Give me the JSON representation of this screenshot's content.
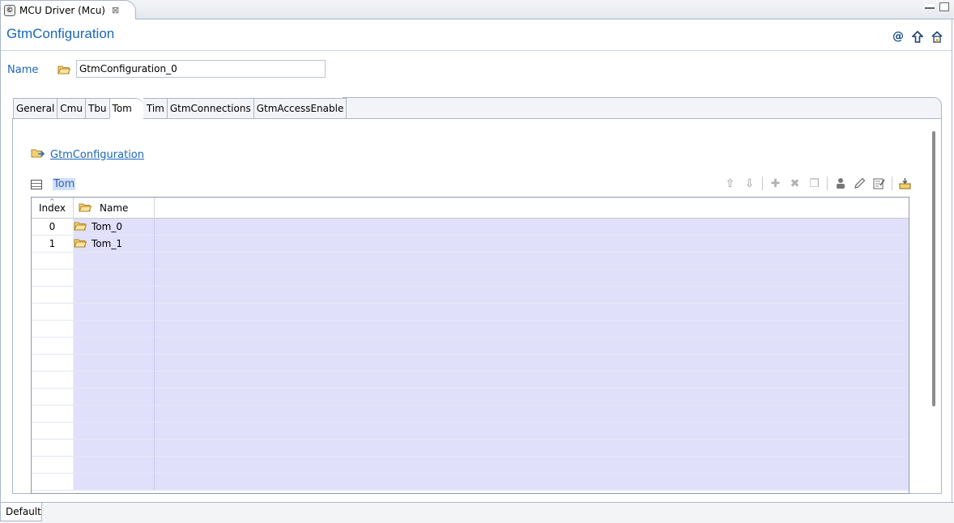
{
  "editor": {
    "tab_title": "MCU Driver (Mcu)",
    "close_glyph": "⊠"
  },
  "header": {
    "title": "GtmConfiguration"
  },
  "name_field": {
    "label": "Name",
    "value": "GtmConfiguration_0"
  },
  "tabs": [
    "General",
    "Cmu",
    "Tbu",
    "Tom",
    "Tim",
    "GtmConnections",
    "GtmAccessEnable"
  ],
  "active_tab": "Tom",
  "breadcrumb": {
    "link": "GtmConfiguration"
  },
  "table": {
    "title": "Tom",
    "columns": [
      "Index",
      "Name"
    ],
    "rows": [
      {
        "index": "0",
        "name": "Tom_0"
      },
      {
        "index": "1",
        "name": "Tom_1"
      }
    ]
  },
  "status": {
    "tab": "Default"
  },
  "colors": {
    "accent": "#1a67b8",
    "row_highlight": "#e0e0fb",
    "frame": "#a9b7c9"
  }
}
